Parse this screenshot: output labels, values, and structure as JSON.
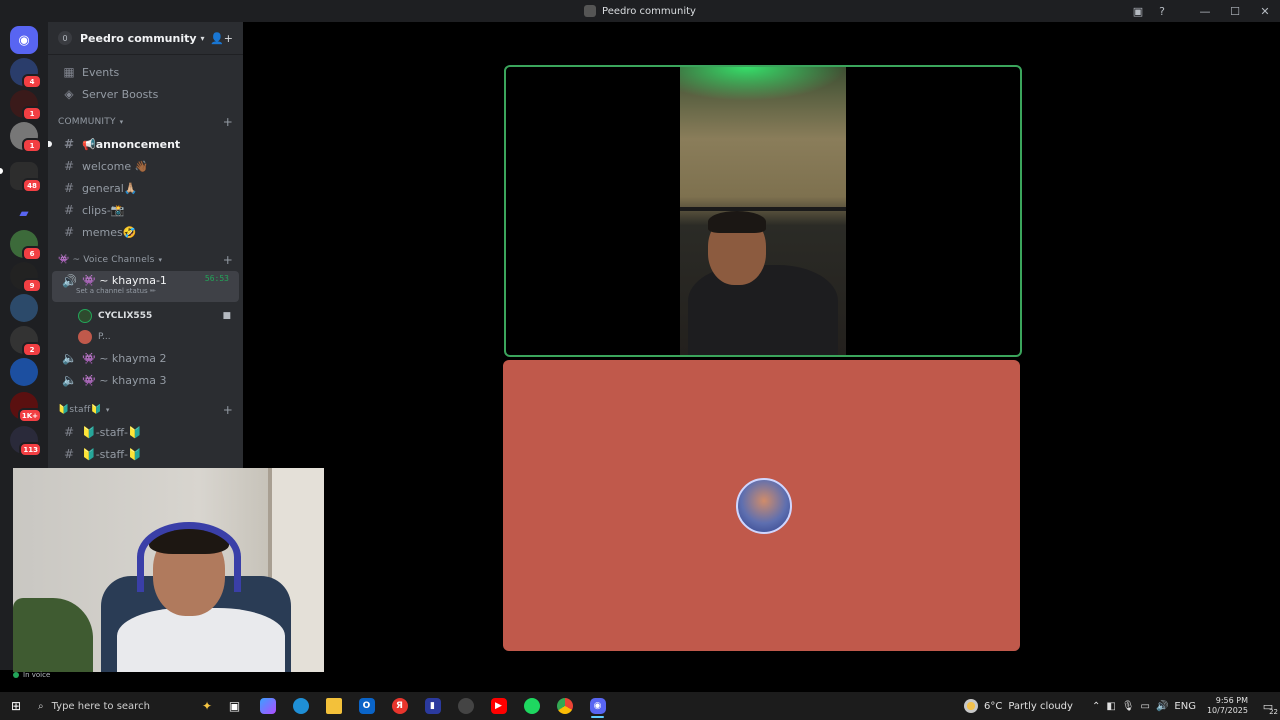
{
  "window": {
    "title": "Peedro community",
    "buttons": [
      "minimize",
      "maximize",
      "close"
    ]
  },
  "server_rail": {
    "servers": [
      {
        "name": "discord-home"
      },
      {
        "name": "server-1",
        "badge": "4"
      },
      {
        "name": "server-2",
        "badge": "1"
      },
      {
        "name": "server-3",
        "badge": "1"
      },
      {
        "name": "server-4",
        "badge": "48"
      },
      {
        "name": "folder"
      },
      {
        "name": "server-5",
        "badge": "6"
      },
      {
        "name": "server-6",
        "badge": "9"
      },
      {
        "name": "server-7"
      },
      {
        "name": "server-8",
        "badge": "2"
      },
      {
        "name": "server-9"
      },
      {
        "name": "server-10",
        "badge": "1K+"
      },
      {
        "name": "server-11",
        "badge": "113"
      }
    ]
  },
  "sidebar": {
    "server_name": "Peedro community",
    "server_count": "0",
    "top_items": [
      {
        "label": "Events"
      },
      {
        "label": "Server Boosts"
      }
    ],
    "categories": [
      {
        "label": "COMMUNITY",
        "channels": [
          {
            "label": "📢annoncement",
            "unread": true
          },
          {
            "label": "welcome 👋🏾"
          },
          {
            "label": "general🙏🏼"
          },
          {
            "label": "clips-📸"
          },
          {
            "label": "memes🤣"
          }
        ]
      },
      {
        "label": "👾 ~ Voice Channels",
        "voice_channels": [
          {
            "label": "👾 ~ khayma-1",
            "status": "Set a channel status ✏",
            "timer": "56:53",
            "active": true,
            "users": [
              {
                "name": "CYCLIX555",
                "camera": true
              },
              {
                "name": "P..."
              }
            ]
          },
          {
            "label": "👾 ~ khayma 2"
          },
          {
            "label": "👾 ~ khayma 3"
          }
        ]
      },
      {
        "label": "🔰staff🔰",
        "channels": [
          {
            "label": "🔰-staff-🔰"
          },
          {
            "label": "🔰-staff-🔰"
          }
        ]
      }
    ],
    "voice_panel": {
      "status": "In voice"
    }
  },
  "stage": {
    "tile1": {
      "type": "camera"
    },
    "tile2": {
      "type": "avatar",
      "color": "#c0594b"
    }
  },
  "taskbar": {
    "search_placeholder": "Type here to search",
    "apps": [
      "task-view",
      "copilot",
      "edge",
      "file-explorer",
      "outlook",
      "yandex",
      "app-chart",
      "app-circle",
      "youtube",
      "spotify",
      "chrome",
      "discord"
    ],
    "weather": {
      "temp": "6°C",
      "condition": "Partly cloudy"
    },
    "language": "ENG",
    "time": "9:56 PM",
    "date": "10/7/2025",
    "notifications": "22"
  },
  "colors": {
    "accent": "#5865f2",
    "speaking_border": "#3ba55c",
    "badge": "#f23f43",
    "sidebar_bg": "#2b2d31",
    "rail_bg": "#1e1f22"
  }
}
